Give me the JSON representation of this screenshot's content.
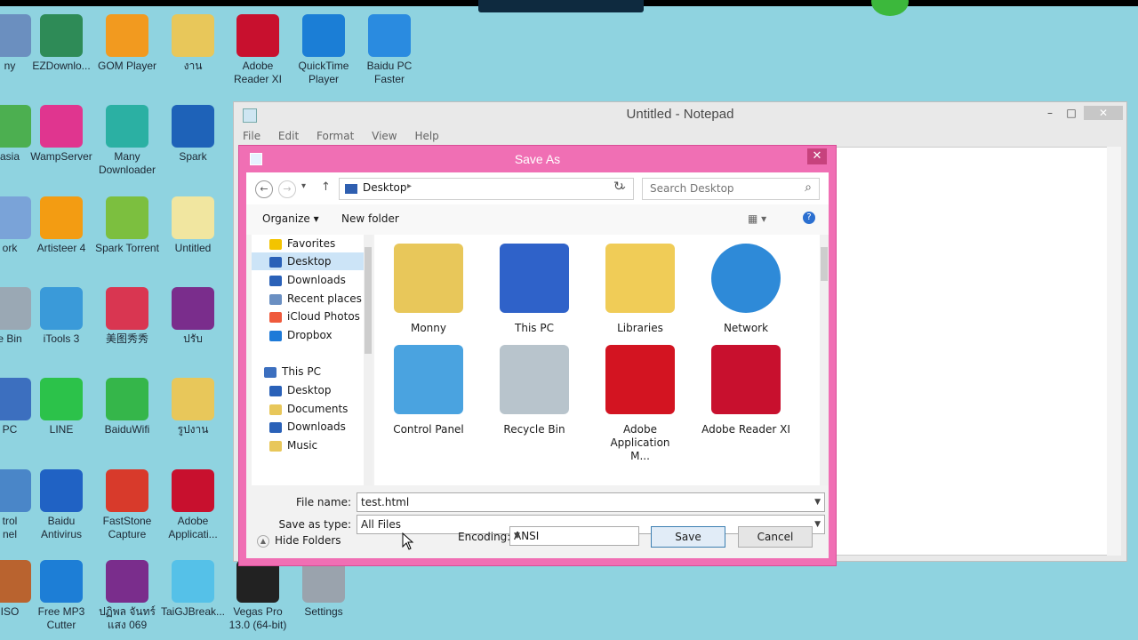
{
  "desktop": {
    "background": "#8fd3e0",
    "icons": [
      {
        "label": "ny",
        "color": "#6b8fbf"
      },
      {
        "label": "EZDownlo...",
        "color": "#2e8b57"
      },
      {
        "label": "GOM Player",
        "color": "#f29a1f"
      },
      {
        "label": "งาน",
        "color": "#e8c75a"
      },
      {
        "label": "Adobe\nReader XI",
        "color": "#c8102e"
      },
      {
        "label": "QuickTime\nPlayer",
        "color": "#1b7ed6"
      },
      {
        "label": "Baidu PC\nFaster",
        "color": "#2a8be0"
      },
      {
        "label": "asia",
        "color": "#4caf50"
      },
      {
        "label": "WampServer",
        "color": "#e0358f"
      },
      {
        "label": "Many\nDownloader",
        "color": "#2bb0a3"
      },
      {
        "label": "Spark",
        "color": "#1e62b8"
      },
      {
        "label": "ork",
        "color": "#7aa3d8"
      },
      {
        "label": "Artisteer 4",
        "color": "#f39c12"
      },
      {
        "label": "Spark Torrent",
        "color": "#7cbf3f"
      },
      {
        "label": "Untitled",
        "color": "#f1e6a0"
      },
      {
        "label": "e Bin",
        "color": "#9aa8b4"
      },
      {
        "label": "iTools 3",
        "color": "#3a9ad9"
      },
      {
        "label": "美图秀秀",
        "color": "#d93651"
      },
      {
        "label": "ปรับ",
        "color": "#7a2d8c"
      },
      {
        "label": "PC",
        "color": "#3c6fbf"
      },
      {
        "label": "LINE",
        "color": "#2cc24a"
      },
      {
        "label": "BaiduWifi",
        "color": "#35b64a"
      },
      {
        "label": "รูปงาน",
        "color": "#e8c75a"
      },
      {
        "label": "trol\nnel",
        "color": "#4a86c8"
      },
      {
        "label": "Baidu\nAntivirus",
        "color": "#2062c4"
      },
      {
        "label": "FastStone\nCapture",
        "color": "#d83a2b"
      },
      {
        "label": "Adobe\nApplicati...",
        "color": "#c8102e"
      },
      {
        "label": "ISO",
        "color": "#b9632f"
      },
      {
        "label": "Free MP3\nCutter",
        "color": "#1d7ed6"
      },
      {
        "label": "ปฏิพล จันทร์\nแสง 069",
        "color": "#7a2d8c"
      },
      {
        "label": "TaiGJBreak...",
        "color": "#55c1e8"
      },
      {
        "label": "Vegas Pro\n13.0 (64-bit)",
        "color": "#222222"
      },
      {
        "label": "Settings",
        "color": "#9aa3ad"
      }
    ]
  },
  "notepad": {
    "title": "Untitled - Notepad",
    "menu": [
      "File",
      "Edit",
      "Format",
      "View",
      "Help"
    ],
    "min": "–",
    "max": "□",
    "close": "✕"
  },
  "saveas": {
    "title": "Save As",
    "close": "✕",
    "back": "←",
    "forward": "→",
    "recent": "▾",
    "up": "↑",
    "location": "Desktop",
    "location_sep": "▸",
    "dropdown": "⌄",
    "refresh": "↻",
    "search_placeholder": "Search Desktop",
    "organize": "Organize ▾",
    "new_folder": "New folder",
    "view_icon": "▦ ▾",
    "help_icon": "?",
    "nav": [
      {
        "label": "Favorites",
        "color": "#f3c400",
        "selected": false
      },
      {
        "label": "Desktop",
        "color": "#2a61b8",
        "selected": true
      },
      {
        "label": "Downloads",
        "color": "#2a61b8",
        "selected": false
      },
      {
        "label": "Recent places",
        "color": "#6a8fc2",
        "selected": false
      },
      {
        "label": "iCloud Photos",
        "color": "#ef5a3c",
        "selected": false
      },
      {
        "label": "Dropbox",
        "color": "#1d7ad8",
        "selected": false
      },
      {
        "label": "This PC",
        "color": "#3c6fbf",
        "selected": false
      },
      {
        "label": "Desktop",
        "color": "#2a61b8",
        "selected": false
      },
      {
        "label": "Documents",
        "color": "#e8c75a",
        "selected": false
      },
      {
        "label": "Downloads",
        "color": "#2a61b8",
        "selected": false
      },
      {
        "label": "Music",
        "color": "#e8c75a",
        "selected": false
      }
    ],
    "files": [
      {
        "label": "Monny",
        "color": "#e8c75a"
      },
      {
        "label": "This PC",
        "color": "#2f62c9"
      },
      {
        "label": "Libraries",
        "color": "#f0cc57"
      },
      {
        "label": "Network",
        "color": "#2e8ad8"
      },
      {
        "label": "Control Panel",
        "color": "#4aa3e0"
      },
      {
        "label": "Recycle Bin",
        "color": "#b8c4cc"
      },
      {
        "label": "Adobe\nApplication\nM...",
        "color": "#d31421"
      },
      {
        "label": "Adobe Reader XI",
        "color": "#c8102e"
      }
    ],
    "filename_label": "File name:",
    "filename_value": "test.html",
    "type_label": "Save as type:",
    "type_value": "All Files",
    "hide_folders": "Hide Folders",
    "encoding_label": "Encoding:",
    "encoding_value": "ANSI",
    "save": "Save",
    "cancel": "Cancel"
  }
}
